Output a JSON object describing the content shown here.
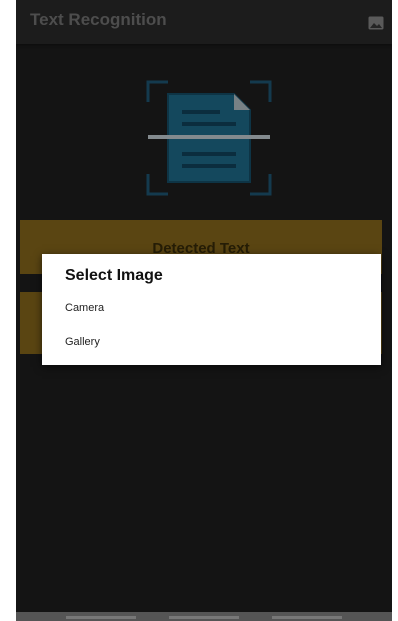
{
  "appbar": {
    "title": "Text Recognition",
    "action_icon": "image-icon"
  },
  "main": {
    "scan_icon": "document-scan-icon",
    "detected_label": "Detected Text"
  },
  "dialog": {
    "title": "Select Image",
    "options": [
      "Camera",
      "Gallery"
    ]
  },
  "colors": {
    "background": "#1f1f1f",
    "appbar": "#2b2b2b",
    "accent_bar": "#8a6a1c",
    "scan_icon": "#1f6f8f"
  }
}
